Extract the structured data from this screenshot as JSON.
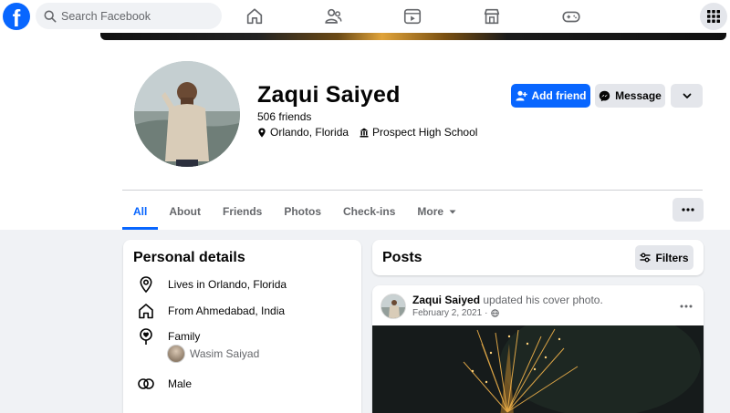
{
  "topbar": {
    "search_placeholder": "Search Facebook",
    "logo_letter": "f",
    "nav": [
      "home-icon",
      "friends-icon",
      "watch-icon",
      "marketplace-icon",
      "gaming-icon"
    ],
    "menu_icon": "grid-menu-icon"
  },
  "profile": {
    "name": "Zaqui Saiyed",
    "friends": "506 friends",
    "location": "Orlando, Florida",
    "school": "Prospect High School",
    "add_friend_label": "Add friend",
    "message_label": "Message"
  },
  "tabs": [
    {
      "label": "All",
      "active": true
    },
    {
      "label": "About"
    },
    {
      "label": "Friends"
    },
    {
      "label": "Photos"
    },
    {
      "label": "Check-ins"
    },
    {
      "label": "More"
    }
  ],
  "personal_details": {
    "title": "Personal details",
    "lives_in": "Lives in Orlando, Florida",
    "from": "From Ahmedabad, India",
    "family_label": "Family",
    "family_member": "Wasim Saiyad",
    "gender": "Male"
  },
  "posts": {
    "title": "Posts",
    "filters_label": "Filters",
    "post": {
      "author": "Zaqui Saiyed",
      "action": "updated his cover photo.",
      "date": "February 2, 2021",
      "privacy_icon": "globe-icon"
    }
  },
  "colors": {
    "brand": "#0866ff",
    "background": "#f0f2f5",
    "secondary_button": "#e4e6eb"
  }
}
